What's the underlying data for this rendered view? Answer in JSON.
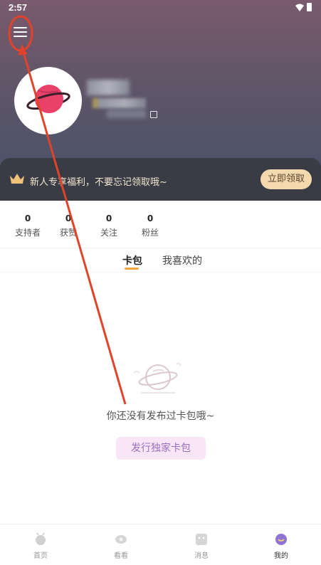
{
  "status_bar": {
    "time": "2:57",
    "icons": [
      "wifi-icon",
      "battery-icon"
    ]
  },
  "header": {
    "menu_icon": "hamburger-menu-icon",
    "avatar_icon": "planet-icon"
  },
  "banner": {
    "text": "新人专享福利，不要忘记领取哦~",
    "button_label": "立即领取",
    "icon": "crown-icon"
  },
  "stats": [
    {
      "value": "0",
      "label": "支持者"
    },
    {
      "value": "0",
      "label": "获赞"
    },
    {
      "value": "0",
      "label": "关注"
    },
    {
      "value": "0",
      "label": "粉丝"
    }
  ],
  "tabs": [
    {
      "label": "卡包",
      "active": true
    },
    {
      "label": "我喜欢的",
      "active": false
    }
  ],
  "empty_state": {
    "icon": "planet-icon",
    "text": "你还没有发布过卡包哦~",
    "button_label": "发行独家卡包"
  },
  "bottom_nav": [
    {
      "label": "首页",
      "icon": "home-icon",
      "active": false
    },
    {
      "label": "看看",
      "icon": "eye-icon",
      "active": false
    },
    {
      "label": "消息",
      "icon": "message-icon",
      "active": false
    },
    {
      "label": "我的",
      "icon": "profile-icon",
      "active": true
    }
  ],
  "colors": {
    "accent": "#f3a43a",
    "banner_button": "#f4d9ae",
    "publish_button_text": "#9a6fc3",
    "annotation": "#e0432b"
  }
}
